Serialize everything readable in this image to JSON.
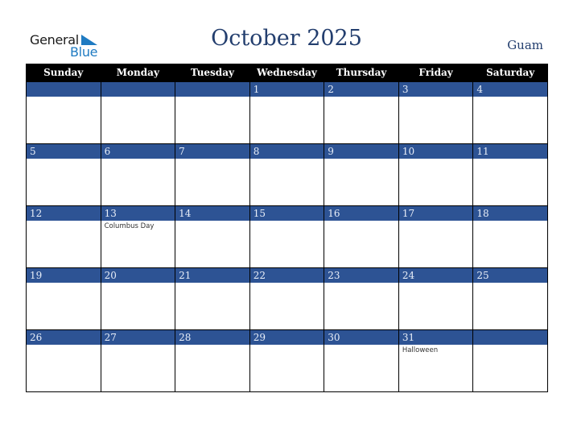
{
  "logo": {
    "line1": "General",
    "line2": "Blue"
  },
  "title": "October 2025",
  "region": "Guam",
  "colors": {
    "title": "#233e6e",
    "day_bar": "#2d5394",
    "header_bg": "#000000",
    "logo_blue": "#1f7bc2"
  },
  "weekdays": [
    "Sunday",
    "Monday",
    "Tuesday",
    "Wednesday",
    "Thursday",
    "Friday",
    "Saturday"
  ],
  "weeks": [
    [
      {
        "day": "",
        "event": ""
      },
      {
        "day": "",
        "event": ""
      },
      {
        "day": "",
        "event": ""
      },
      {
        "day": "1",
        "event": ""
      },
      {
        "day": "2",
        "event": ""
      },
      {
        "day": "3",
        "event": ""
      },
      {
        "day": "4",
        "event": ""
      }
    ],
    [
      {
        "day": "5",
        "event": ""
      },
      {
        "day": "6",
        "event": ""
      },
      {
        "day": "7",
        "event": ""
      },
      {
        "day": "8",
        "event": ""
      },
      {
        "day": "9",
        "event": ""
      },
      {
        "day": "10",
        "event": ""
      },
      {
        "day": "11",
        "event": ""
      }
    ],
    [
      {
        "day": "12",
        "event": ""
      },
      {
        "day": "13",
        "event": "Columbus Day"
      },
      {
        "day": "14",
        "event": ""
      },
      {
        "day": "15",
        "event": ""
      },
      {
        "day": "16",
        "event": ""
      },
      {
        "day": "17",
        "event": ""
      },
      {
        "day": "18",
        "event": ""
      }
    ],
    [
      {
        "day": "19",
        "event": ""
      },
      {
        "day": "20",
        "event": ""
      },
      {
        "day": "21",
        "event": ""
      },
      {
        "day": "22",
        "event": ""
      },
      {
        "day": "23",
        "event": ""
      },
      {
        "day": "24",
        "event": ""
      },
      {
        "day": "25",
        "event": ""
      }
    ],
    [
      {
        "day": "26",
        "event": ""
      },
      {
        "day": "27",
        "event": ""
      },
      {
        "day": "28",
        "event": ""
      },
      {
        "day": "29",
        "event": ""
      },
      {
        "day": "30",
        "event": ""
      },
      {
        "day": "31",
        "event": "Halloween"
      },
      {
        "day": "",
        "event": ""
      }
    ]
  ]
}
